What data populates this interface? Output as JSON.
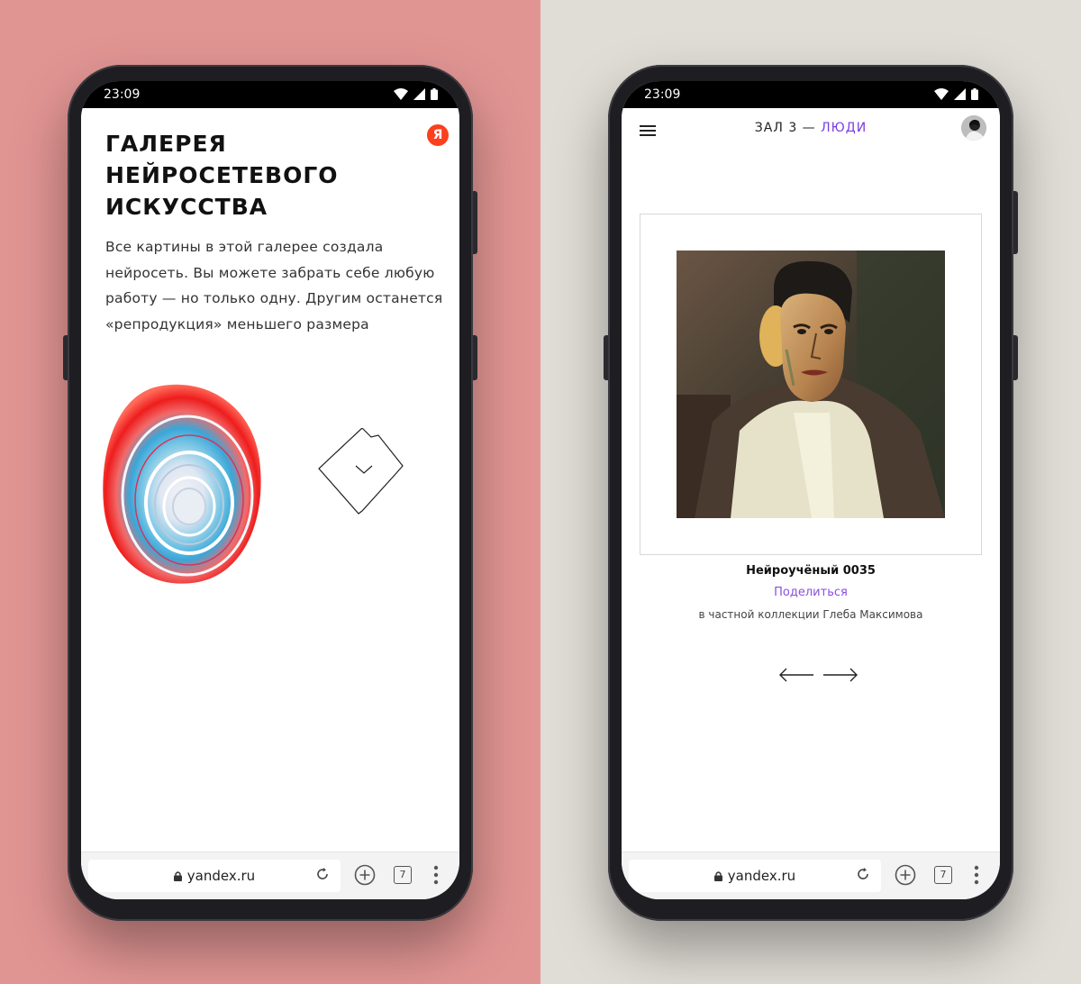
{
  "colors": {
    "left_bg": "#e19593",
    "right_bg": "#e0ddd6",
    "accent_purple": "#7a3ee0",
    "yandex_red": "#fc3f1d"
  },
  "left_phone": {
    "status": {
      "time": "23:09"
    },
    "yandex_logo": "Я",
    "title_lines": [
      "ГАЛЕРЕЯ",
      "НЕЙРОСЕТЕВОГО",
      "ИСКУССТВА"
    ],
    "intro": "Все картины в этой галерее создала нейросеть. Вы можете забрать себе любую работу — но только одну. Другим останется «репродукция» меньшего размера",
    "browser": {
      "url": "yandex.ru",
      "tab_count": "7"
    }
  },
  "right_phone": {
    "status": {
      "time": "23:09"
    },
    "header": {
      "hall": "ЗАЛ 3 — ",
      "hall_name": "ЛЮДИ"
    },
    "artwork": {
      "title": "Нейроучёный 0035",
      "share_label": "Поделиться",
      "collection": "в частной коллекции Глеба Максимова"
    },
    "browser": {
      "url": "yandex.ru",
      "tab_count": "7"
    }
  }
}
